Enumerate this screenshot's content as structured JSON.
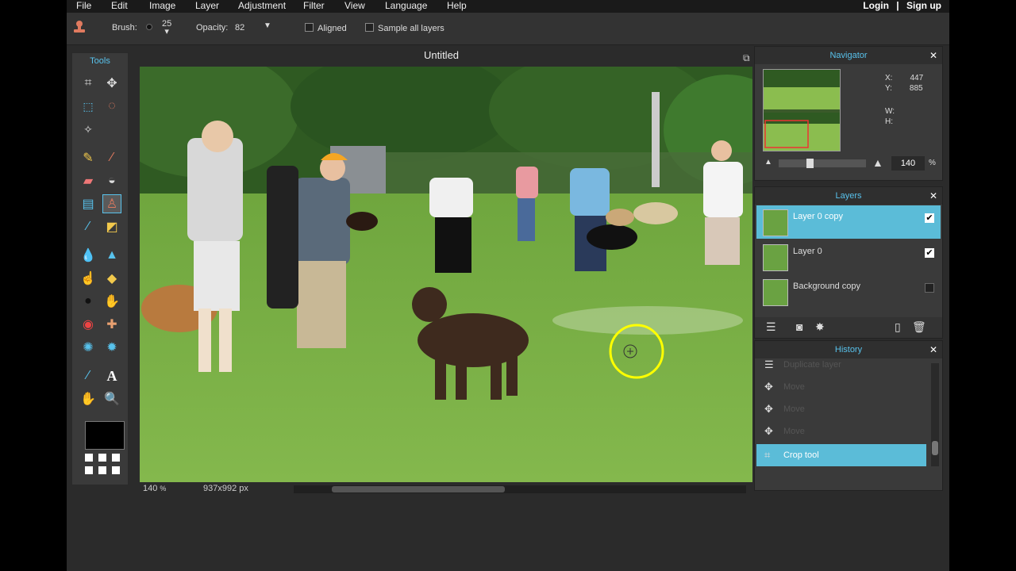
{
  "menu": [
    "File",
    "Edit",
    "Image",
    "Layer",
    "Adjustment",
    "Filter",
    "View",
    "Language",
    "Help"
  ],
  "auth": {
    "login": "Login",
    "sep": "|",
    "signup": "Sign up"
  },
  "options": {
    "brush_label": "Brush:",
    "brush_value": "25",
    "opacity_label": "Opacity:",
    "opacity_value": "82",
    "aligned_label": "Aligned",
    "sample_all_label": "Sample all layers"
  },
  "tools": {
    "title": "Tools",
    "selected": "clone-stamp"
  },
  "document": {
    "title": "Untitled",
    "zoom": "140",
    "zoom_unit": "%",
    "size": "937x992 px"
  },
  "navigator": {
    "title": "Navigator",
    "x_label": "X:",
    "x_value": "447",
    "y_label": "Y:",
    "y_value": "885",
    "w_label": "W:",
    "h_label": "H:",
    "zoom_value": "140",
    "zoom_unit": "%",
    "zoom_level_fraction": 0.35
  },
  "layers": {
    "title": "Layers",
    "items": [
      {
        "name": "Layer 0 copy",
        "visible": true,
        "selected": true
      },
      {
        "name": "Layer 0",
        "visible": true,
        "selected": false
      },
      {
        "name": "Background copy",
        "visible": false,
        "selected": false
      }
    ]
  },
  "history": {
    "title": "History",
    "items": [
      "Duplicate layer",
      "Move",
      "Move",
      "Move",
      "Crop tool"
    ],
    "selected": "Crop tool"
  },
  "colors": {
    "accent": "#58c2ec",
    "selected_row": "#5bbcd8",
    "brush_cursor": "#ffff00"
  }
}
